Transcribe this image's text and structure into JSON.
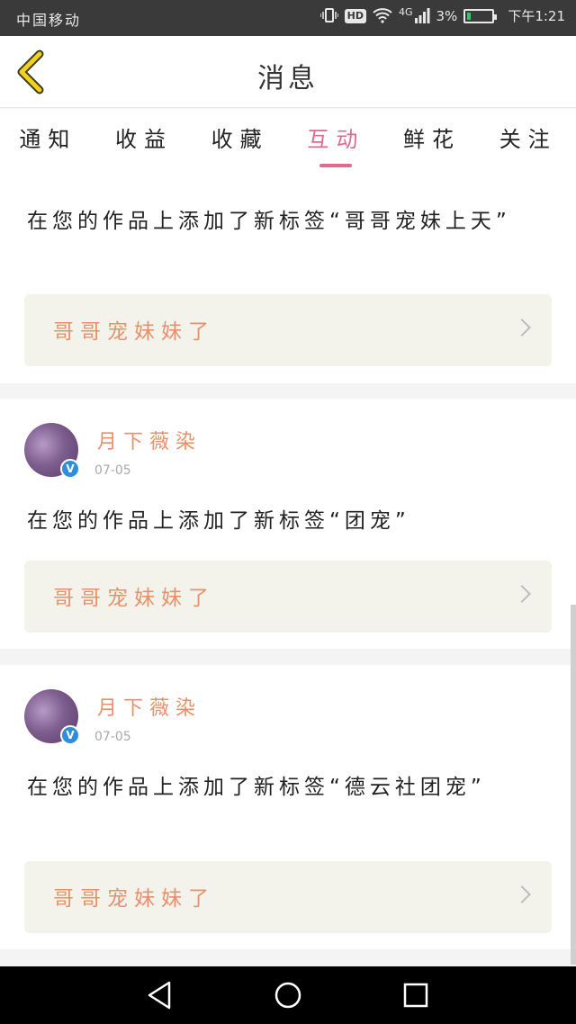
{
  "status_bar": {
    "carrier": "中国移动",
    "network": "4G",
    "battery_percent": "3%",
    "time": "下午1:21",
    "hd_label": "HD"
  },
  "header": {
    "title": "消息"
  },
  "tabs": [
    {
      "label": "通知"
    },
    {
      "label": "收益"
    },
    {
      "label": "收藏"
    },
    {
      "label": "互动",
      "active": true
    },
    {
      "label": "鲜花"
    },
    {
      "label": "关注"
    }
  ],
  "messages": [
    {
      "text": "在您的作品上添加了新标签“哥哥宠妹上天”",
      "work_title": "哥哥宠妹妹了"
    },
    {
      "user": "月下薇染",
      "date": "07-05",
      "text": "在您的作品上添加了新标签“团宠”",
      "work_title": "哥哥宠妹妹了"
    },
    {
      "user": "月下薇染",
      "date": "07-05",
      "text": "在您的作品上添加了新标签“德云社团宠”",
      "work_title": "哥哥宠妹妹了"
    }
  ],
  "colors": {
    "accent": "#e06a8e",
    "name_orange": "#e8906a",
    "work_box_bg": "#f3f3ec",
    "status_bar_bg": "#3a3a3a"
  }
}
